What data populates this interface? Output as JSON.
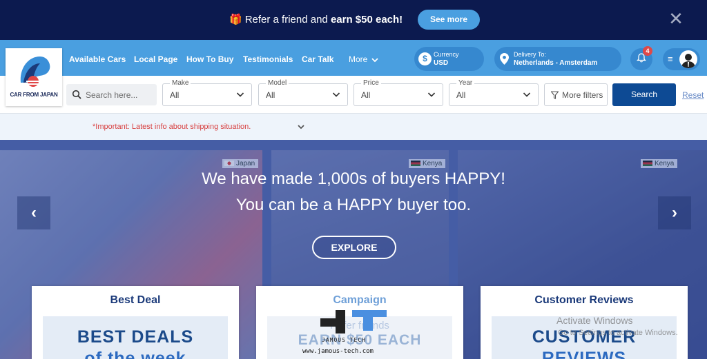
{
  "promo": {
    "text_pre": "Refer a friend and ",
    "text_bold": "earn $50 each!",
    "button": "See more",
    "close": "✕"
  },
  "logo": {
    "text": "CAR FROM JAPAN"
  },
  "nav": {
    "items": [
      "Available Cars",
      "Local Page",
      "How To Buy",
      "Testimonials",
      "Car Talk"
    ],
    "more": "More"
  },
  "currency": {
    "label": "Currency",
    "value": "USD",
    "icon": "$"
  },
  "delivery": {
    "label": "Delivery To:",
    "value": "Netherlands - Amsterdam"
  },
  "notifications": {
    "count": "4"
  },
  "search": {
    "placeholder": "Search here...",
    "filters": [
      {
        "label": "Make",
        "value": "All"
      },
      {
        "label": "Model",
        "value": "All"
      },
      {
        "label": "Price",
        "value": "All"
      },
      {
        "label": "Year",
        "value": "All"
      }
    ],
    "more_filters": "More filters",
    "search_button": "Search",
    "reset": "Reset"
  },
  "notice": {
    "text": "*Important: Latest info about shipping situation."
  },
  "hero": {
    "line1": "We have made 1,000s of buyers HAPPY!",
    "line2": "You can be a HAPPY buyer too.",
    "explore": "EXPLORE",
    "tags": [
      "Japan",
      "Kenya",
      "Kenya"
    ],
    "prev": "‹",
    "next": "›"
  },
  "cards": [
    {
      "title": "Best Deal",
      "big": "BEST DEALS",
      "big2": "of the week"
    },
    {
      "title": "Campaign",
      "sub": "Refer friends",
      "big": "EARN $50 EACH"
    },
    {
      "title": "Customer Reviews",
      "big": "CUSTOMER",
      "big2": "REVIEWS"
    }
  ],
  "watermark": {
    "name": "JAMOUS TECH",
    "url": "www.jamous-tech.com"
  },
  "windows": {
    "line1": "Activate Windows",
    "line2": "Go to Settings to activate Windows."
  }
}
